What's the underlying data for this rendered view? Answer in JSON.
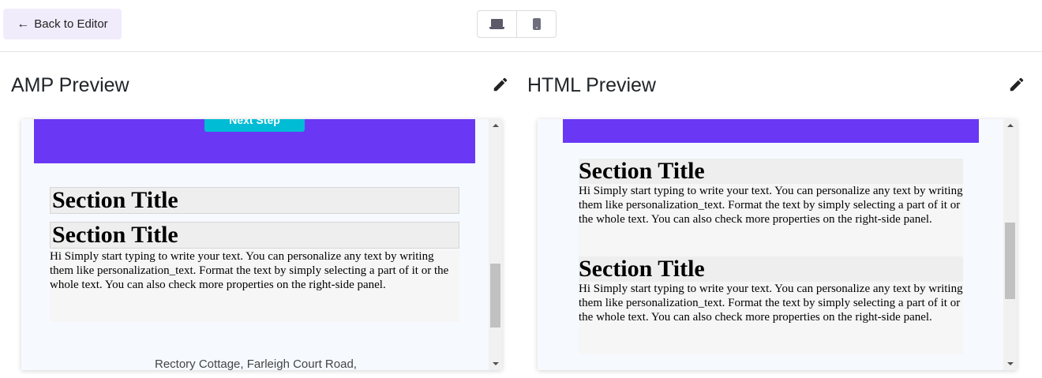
{
  "toolbar": {
    "back_label": "Back to Editor",
    "back_icon": "arrow-left-icon",
    "device_options": [
      "laptop-icon",
      "mobile-icon"
    ]
  },
  "amp": {
    "title": "AMP Preview",
    "button_text": "Next Step",
    "section_title_1": "Section Title",
    "section_title_2": "Section Title",
    "body": "Hi Simply start typing to write your text. You can personalize any text by writing them like personalization_text. Format the text by simply selecting a part of it or the whole text. You can also check more properties on the right-side panel.",
    "footer_address": "Rectory Cottage, Farleigh Court Road,"
  },
  "html": {
    "title": "HTML Preview",
    "section_title_1": "Section Title",
    "body_1": "Hi Simply start typing to write your text. You can personalize any text by writing them like personalization_text. Format the text by simply selecting a part of it or the whole text. You can also check more properties on the right-side panel.",
    "section_title_2": "Section Title",
    "body_2": "Hi Simply start typing to write your text. You can personalize any text by writing them like personalization_text. Format the text by simply selecting a part of it or the whole text. You can also check more properties on the right-side panel."
  },
  "colors": {
    "banner": "#6a38f5",
    "button": "#00bcd4",
    "back_button_bg": "#f1ecfb"
  }
}
